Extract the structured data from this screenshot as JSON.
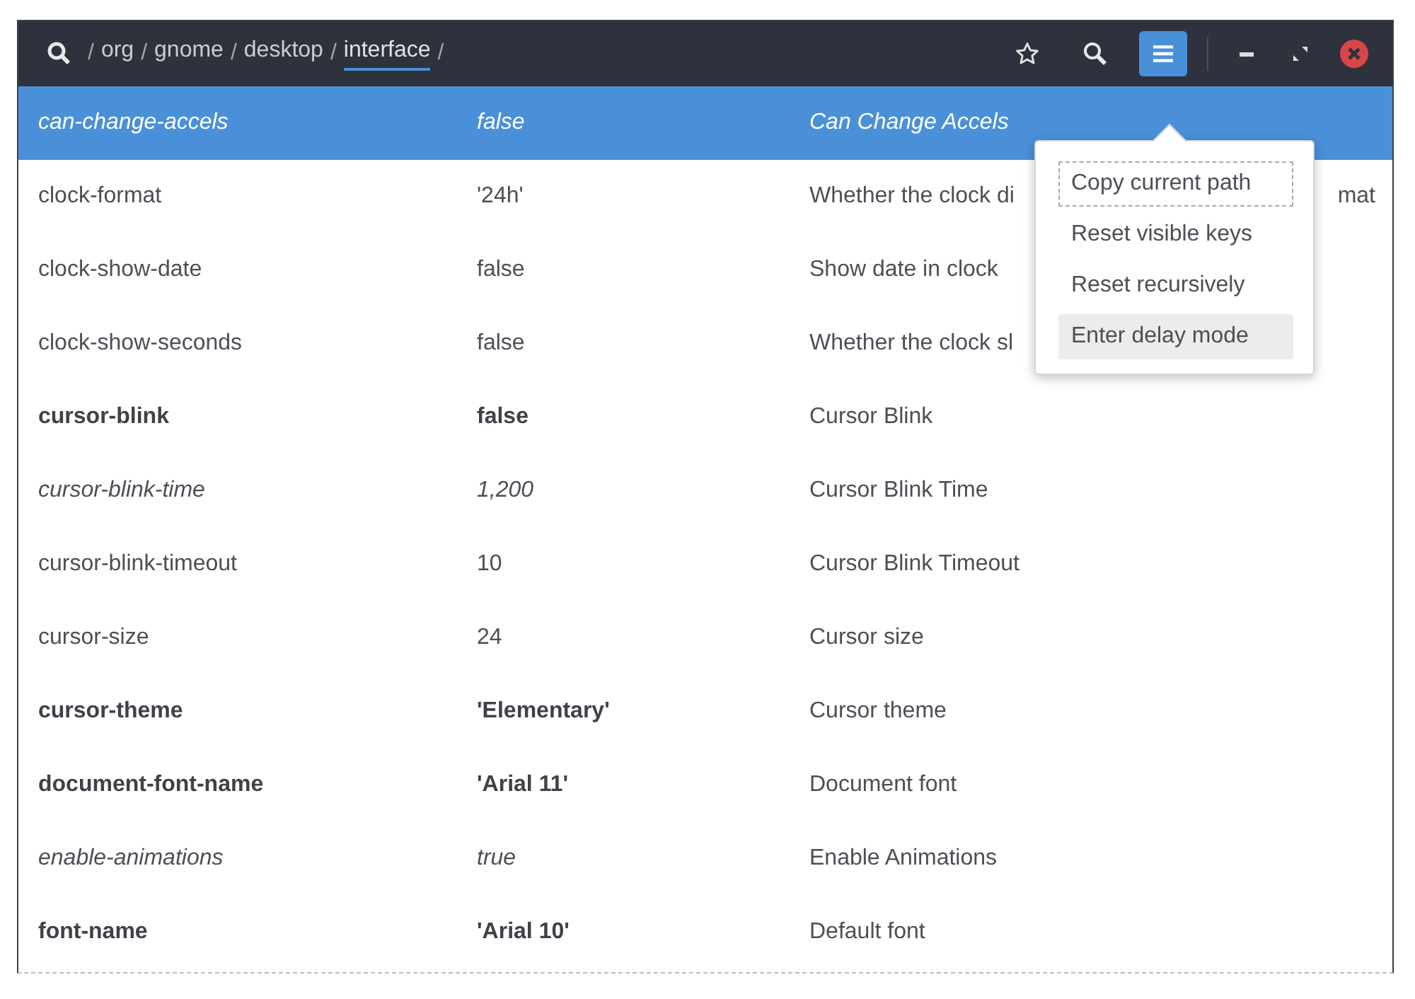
{
  "path": {
    "segments": [
      {
        "label": "org",
        "selected": false
      },
      {
        "label": "gnome",
        "selected": false
      },
      {
        "label": "desktop",
        "selected": false
      },
      {
        "label": "interface",
        "selected": true
      }
    ],
    "separator": "/"
  },
  "menu_button": {
    "on": true
  },
  "keys": [
    {
      "name": "can-change-accels",
      "value": "false",
      "description": "Can Change Accels",
      "kind": "italic",
      "selected": true
    },
    {
      "name": "clock-format",
      "value": "'24h'",
      "description": "Whether the clock di",
      "description_tail": "mat",
      "kind": "plain",
      "selected": false
    },
    {
      "name": "clock-show-date",
      "value": "false",
      "description": "Show date in clock",
      "kind": "plain",
      "selected": false
    },
    {
      "name": "clock-show-seconds",
      "value": "false",
      "description": "Whether the clock sl",
      "kind": "plain",
      "selected": false
    },
    {
      "name": "cursor-blink",
      "value": "false",
      "description": "Cursor Blink",
      "kind": "bold",
      "selected": false
    },
    {
      "name": "cursor-blink-time",
      "value": "1,200",
      "description": "Cursor Blink Time",
      "kind": "italic",
      "selected": false
    },
    {
      "name": "cursor-blink-timeout",
      "value": "10",
      "description": "Cursor Blink Timeout",
      "kind": "plain",
      "selected": false
    },
    {
      "name": "cursor-size",
      "value": "24",
      "description": "Cursor size",
      "kind": "plain",
      "selected": false
    },
    {
      "name": "cursor-theme",
      "value": "'Elementary'",
      "description": "Cursor theme",
      "kind": "bold",
      "selected": false
    },
    {
      "name": "document-font-name",
      "value": "'Arial 11'",
      "description": "Document font",
      "kind": "bold",
      "selected": false
    },
    {
      "name": "enable-animations",
      "value": "true",
      "description": "Enable Animations",
      "kind": "italic",
      "selected": false
    },
    {
      "name": "font-name",
      "value": "'Arial 10'",
      "description": "Default font",
      "kind": "bold",
      "selected": false
    }
  ],
  "menu": [
    {
      "label": "Copy current path",
      "focused": true,
      "hovered": false
    },
    {
      "label": "Reset visible keys",
      "focused": false,
      "hovered": false
    },
    {
      "label": "Reset recursively",
      "focused": false,
      "hovered": false
    },
    {
      "label": "Enter delay mode",
      "focused": false,
      "hovered": true
    }
  ]
}
